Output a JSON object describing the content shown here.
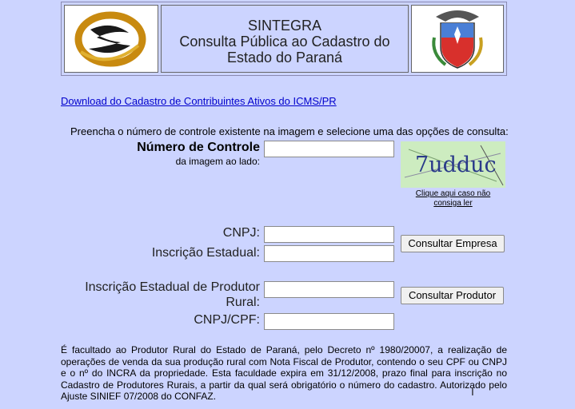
{
  "header": {
    "title": "SINTEGRA",
    "subtitle_line1": "Consulta Pública ao Cadastro do",
    "subtitle_line2": "Estado do Paraná"
  },
  "download_link": "Download do Cadastro de Contribuintes Ativos do ICMS/PR",
  "instruction": "Preencha o número de controle existente na imagem e selecione uma das opções de consulta:",
  "control": {
    "label": "Número de Controle",
    "sublabel": "da imagem ao lado:",
    "captcha_text": "7udduc",
    "captcha_help_line1": "Clique aqui caso não",
    "captcha_help_line2": "consiga ler"
  },
  "empresa": {
    "cnpj_label": "CNPJ:",
    "ie_label": "Inscrição Estadual:",
    "button": "Consultar Empresa"
  },
  "produtor": {
    "ie_label_line1": "Inscrição Estadual de Produtor",
    "ie_label_line2": "Rural:",
    "cpf_label": "CNPJ/CPF:",
    "button": "Consultar Produtor"
  },
  "notice": "É facultado ao Produtor Rural do Estado de Paraná, pelo Decreto nº 1980/20007, a realização de operações de venda da sua produção rural com Nota Fiscal de Produtor, contendo o seu CPF ou CNPJ e o nº do INCRA da propriedade. Esta faculdade expira em 31/12/2008, prazo final para inscrição no Cadastro de Produtores Rurais, a partir da qual será obrigatório o número do cadastro. Autorizado pelo Ajuste SINIEF 07/2008 do CONFAZ.",
  "colors": {
    "background": "#ccd4ff",
    "link": "#0000cc",
    "captcha_bg": "#cdecc0"
  }
}
